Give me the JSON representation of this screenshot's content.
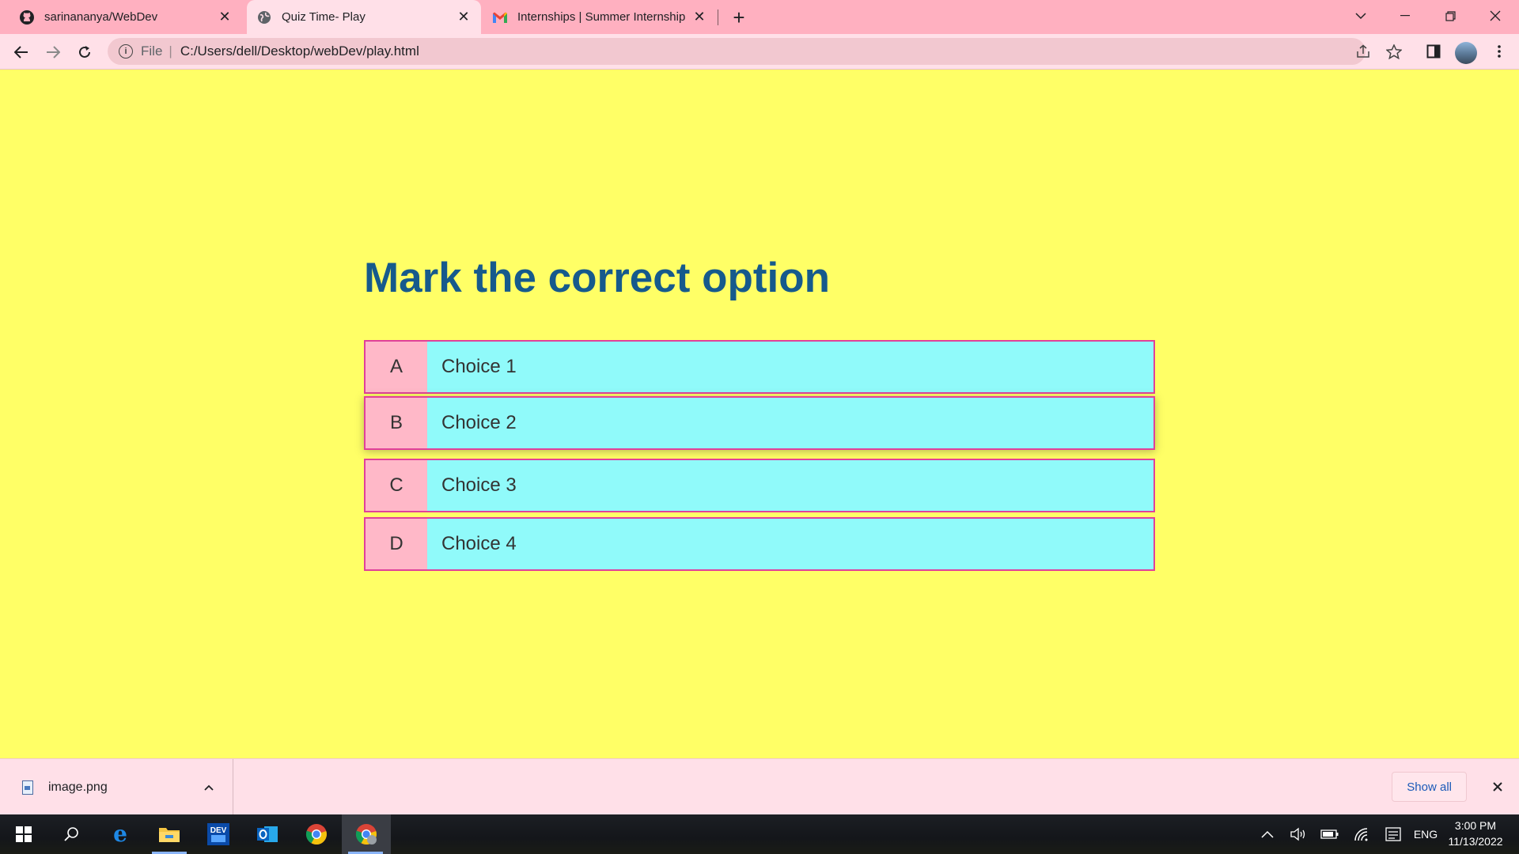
{
  "browser": {
    "tabs": [
      {
        "title": "sarinananya/WebDev",
        "icon": "github-icon",
        "active": false
      },
      {
        "title": "Quiz Time- Play",
        "icon": "globe-icon",
        "active": true
      },
      {
        "title": "Internships | Summer Internship",
        "icon": "gmail-icon",
        "active": false
      }
    ],
    "address": {
      "scheme": "File",
      "url": "C:/Users/dell/Desktop/webDev/play.html"
    }
  },
  "quiz": {
    "heading": "Mark the correct option",
    "choices": [
      {
        "prefix": "A",
        "text": "Choice 1"
      },
      {
        "prefix": "B",
        "text": "Choice 2"
      },
      {
        "prefix": "C",
        "text": "Choice 3"
      },
      {
        "prefix": "D",
        "text": "Choice 4"
      }
    ]
  },
  "downloads": {
    "file_name": "image.png",
    "show_all_label": "Show all"
  },
  "taskbar": {
    "language": "ENG",
    "time": "3:00 PM",
    "date": "11/13/2022",
    "dev_label": "DEV"
  },
  "colors": {
    "page_background": "#ffff66",
    "heading": "#165a8c",
    "choice_background": "#90fafa",
    "choice_prefix": "#ffb8c8",
    "choice_border": "#e0409a",
    "tab_strip": "#ffb0c0"
  }
}
